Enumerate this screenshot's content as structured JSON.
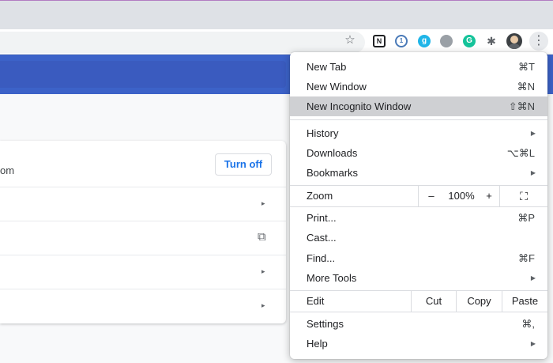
{
  "toolbar": {
    "star_icon": "star-icon",
    "extensions": [
      {
        "name": "notion-extension-icon",
        "glyph": "N"
      },
      {
        "name": "onepassword-extension-icon",
        "glyph": "1"
      },
      {
        "name": "g-extension-icon",
        "glyph": "g"
      },
      {
        "name": "disk-extension-icon",
        "glyph": ""
      },
      {
        "name": "grammarly-extension-icon",
        "glyph": "G"
      },
      {
        "name": "extensions-puzzle-icon",
        "glyph": "✱"
      }
    ],
    "menu_icon": "⋮"
  },
  "page": {
    "partial_text": "om",
    "turn_off_label": "Turn off",
    "row_arrow": "▸",
    "external_link_icon": "⧉"
  },
  "menu": {
    "new_tab": {
      "label": "New Tab",
      "shortcut": "⌘T"
    },
    "new_window": {
      "label": "New Window",
      "shortcut": "⌘N"
    },
    "new_incognito": {
      "label": "New Incognito Window",
      "shortcut": "⇧⌘N"
    },
    "history": {
      "label": "History",
      "arrow": "▶"
    },
    "downloads": {
      "label": "Downloads",
      "shortcut": "⌥⌘L"
    },
    "bookmarks": {
      "label": "Bookmarks",
      "arrow": "▶"
    },
    "zoom": {
      "label": "Zoom",
      "minus": "–",
      "value": "100%",
      "plus": "+",
      "fullscreen": "⛶"
    },
    "print": {
      "label": "Print...",
      "shortcut": "⌘P"
    },
    "cast": {
      "label": "Cast..."
    },
    "find": {
      "label": "Find...",
      "shortcut": "⌘F"
    },
    "more_tools": {
      "label": "More Tools",
      "arrow": "▶"
    },
    "edit": {
      "label": "Edit",
      "cut": "Cut",
      "copy": "Copy",
      "paste": "Paste"
    },
    "settings": {
      "label": "Settings",
      "shortcut": "⌘,"
    },
    "help": {
      "label": "Help",
      "arrow": "▶"
    }
  }
}
